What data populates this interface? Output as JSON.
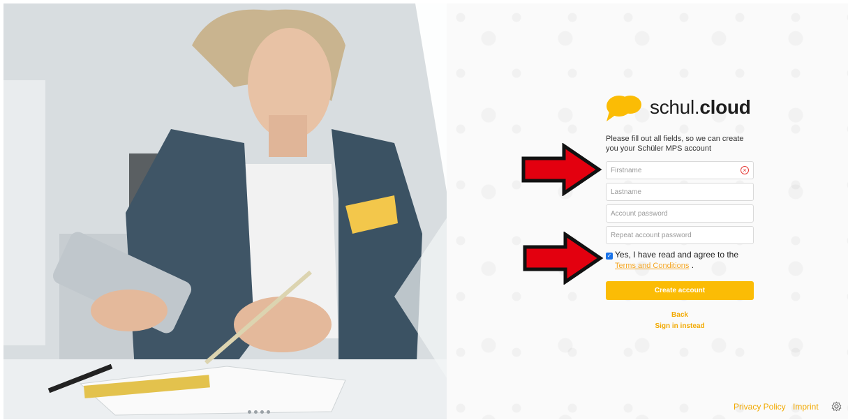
{
  "brand": {
    "name_light": "schul.",
    "name_bold": "cloud"
  },
  "intro_text": "Please fill out all fields, so we can create you your Schüler MPS account",
  "form": {
    "firstname_placeholder": "Firstname",
    "lastname_placeholder": "Lastname",
    "password_placeholder": "Account password",
    "repeat_password_placeholder": "Repeat account password",
    "agree_text": "Yes, I have read and agree to the",
    "terms_link": "Terms and Conditions",
    "terms_suffix": ".",
    "agree_checked": true,
    "create_button": "Create account",
    "back_link": "Back",
    "signin_link": "Sign in instead"
  },
  "footer": {
    "privacy": "Privacy Policy",
    "imprint": "Imprint"
  },
  "carousel": {
    "slides": 4
  },
  "colors": {
    "accent": "#fbbc05",
    "link": "#f2a900",
    "error": "#e53935",
    "arrow": "#e3000f"
  }
}
